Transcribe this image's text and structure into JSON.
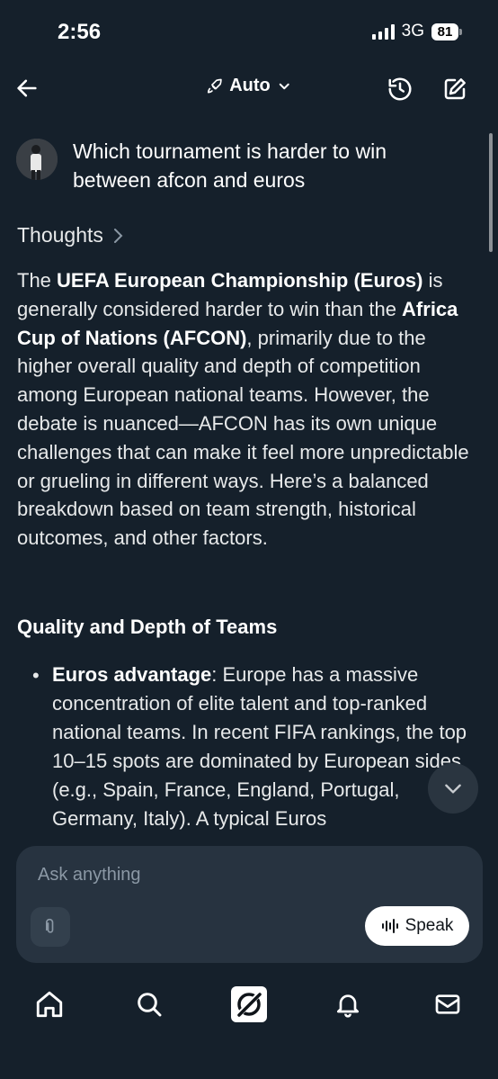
{
  "status_bar": {
    "time": "2:56",
    "network": "3G",
    "battery": "81"
  },
  "header": {
    "model_label": "Auto"
  },
  "conversation": {
    "question": "Which tournament is harder to win between afcon and euros",
    "thoughts_label": "Thoughts",
    "answer": {
      "p1": "The ",
      "b1": "UEFA European Championship (Euros)",
      "p2": " is generally considered harder to win than the ",
      "b2": "Africa Cup of Nations (AFCON)",
      "p3": ", primarily due to the higher overall quality and depth of competition among European national teams. However, the debate is nuanced—AFCON has its own unique challenges that can make it feel more unpredictable or grueling in different ways. Here’s a balanced breakdown based on team strength, historical outcomes, and other factors."
    },
    "section_heading": "Quality and Depth of Teams",
    "bullet": {
      "bold": "Euros advantage",
      "text": ": Europe has a massive concentration of elite talent and top-ranked national teams. In recent FIFA rankings, the top 10–15 spots are dominated by European sides (e.g., Spain, France, England, Portugal, Germany, Italy). A typical Euros"
    }
  },
  "composer": {
    "placeholder": "Ask anything",
    "speak_label": "Speak"
  },
  "icons": {
    "back": "back-arrow-icon",
    "model": "rocket-icon",
    "chevron": "chevron-down-icon",
    "history": "history-icon",
    "new_chat": "compose-icon",
    "attach": "paperclip-icon",
    "speak": "waveform-icon",
    "scroll_down": "chevron-down-icon",
    "tabs": [
      "home-icon",
      "search-icon",
      "grok-icon",
      "bell-icon",
      "mail-icon"
    ]
  }
}
